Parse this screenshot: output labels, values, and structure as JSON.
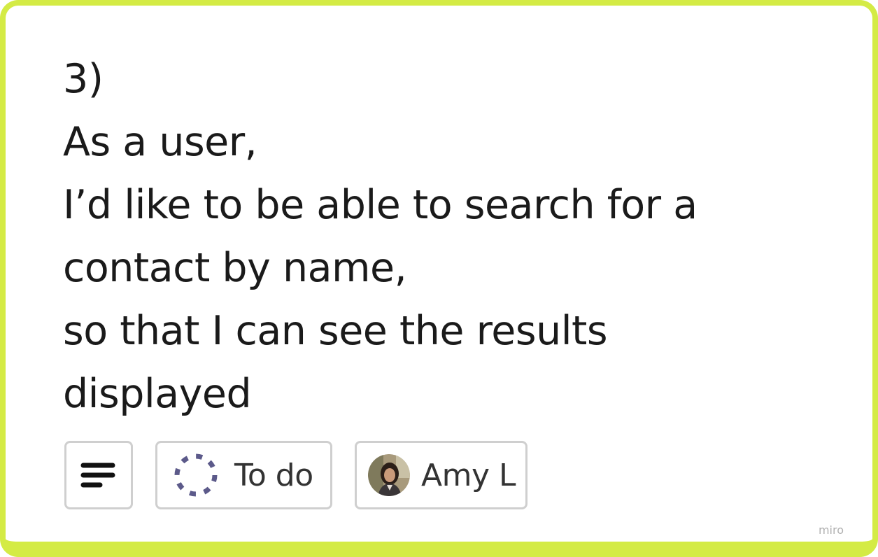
{
  "card": {
    "lines": [
      "3)",
      "As a user,",
      "I’d like to be able to search for a",
      "contact by name,",
      "so that I can see the results",
      "displayed"
    ],
    "border_color": "#d4eb45"
  },
  "chips": {
    "details_icon": "lines-icon",
    "status": {
      "icon": "dashed-circle-icon",
      "icon_color": "#5c5a8a",
      "label": "To do"
    },
    "assignee": {
      "avatar": "user-avatar",
      "label": "Amy L"
    }
  },
  "watermark": {
    "text": "miro"
  }
}
